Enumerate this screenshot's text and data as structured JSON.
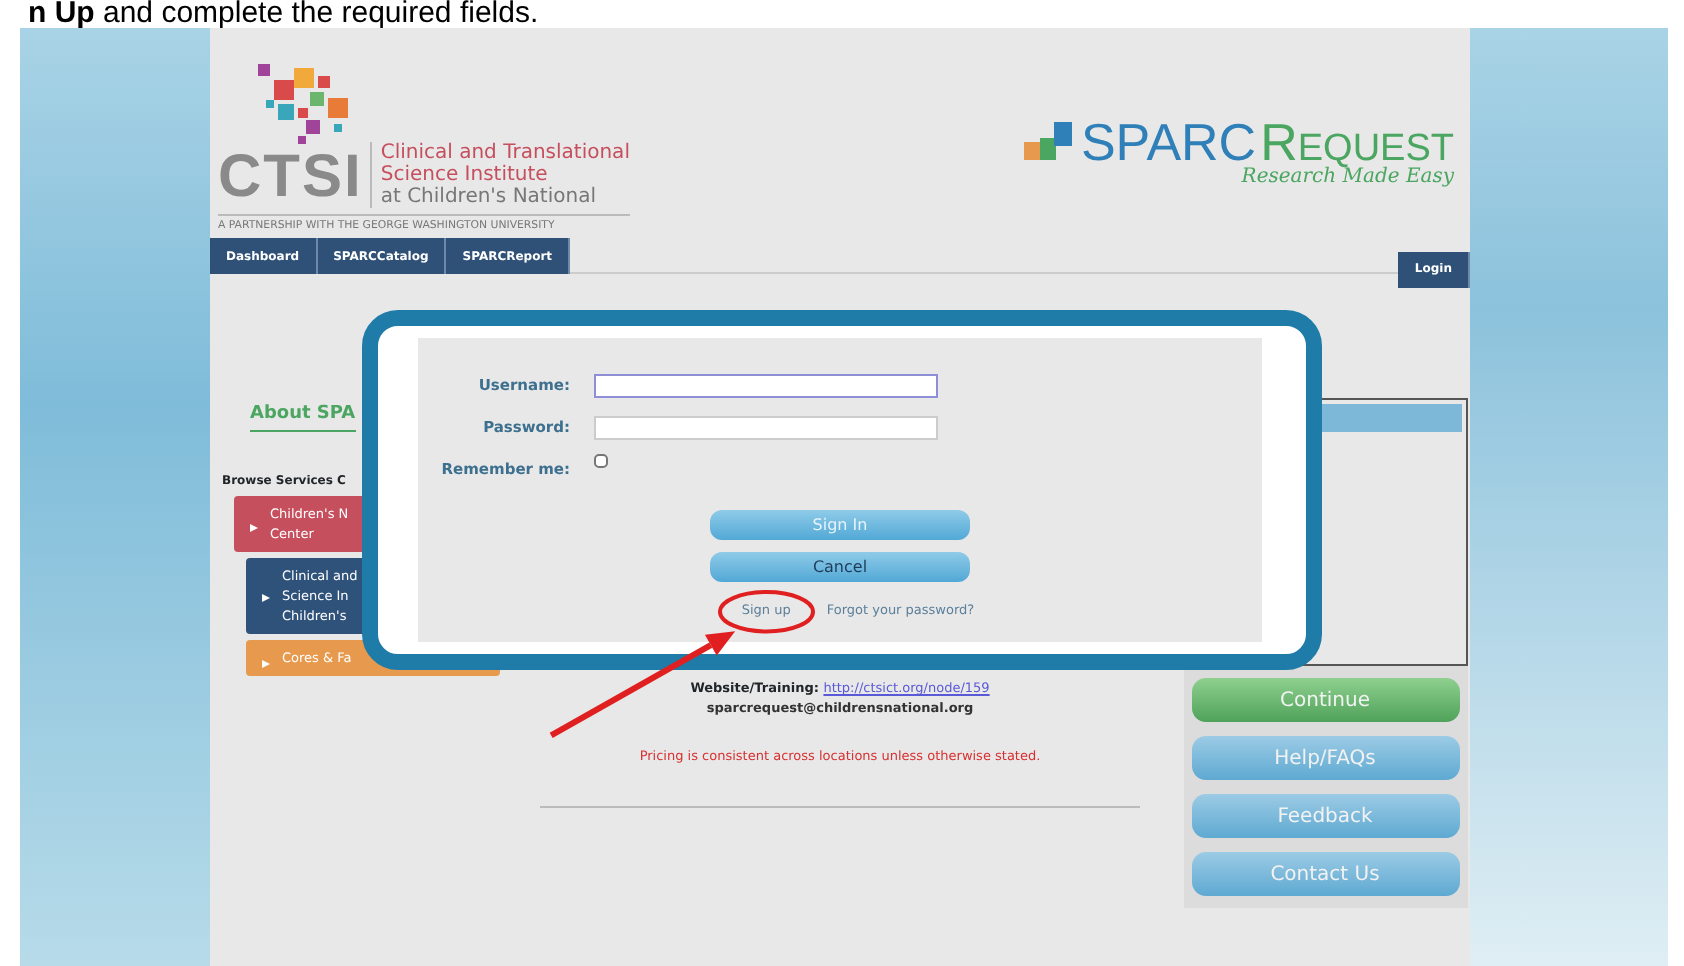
{
  "caption": "**n Up** and complete the required fields.",
  "header": {
    "org_abbr": "CTSI",
    "org_name": [
      "Clinical and Translational",
      "Science Institute",
      "at Children's National"
    ],
    "partnership": "A PARTNERSHIP WITH THE GEORGE WASHINGTON UNIVERSITY",
    "product_name": [
      "SPARC",
      "REQUEST"
    ],
    "tagline": "Research Made Easy"
  },
  "nav": {
    "items": [
      {
        "label": "Dashboard"
      },
      {
        "label": "SPARCCatalog"
      },
      {
        "label": "SPARCReport"
      }
    ],
    "login": "Login"
  },
  "about_title": "About SPA",
  "browse_title": "Browse Services C",
  "categories": [
    {
      "lines": [
        "Children's N",
        "Center"
      ],
      "color": "#c64f5e",
      "children": [
        {
          "lines": [
            "Clinical and",
            "Science In",
            "Children's"
          ],
          "color": "#2f527a"
        },
        {
          "lines": [
            "Cores & Fa"
          ],
          "color": "#e79a4d"
        }
      ]
    }
  ],
  "login_form": {
    "fields": [
      {
        "label": "Username:",
        "kind": "text",
        "focused": true
      },
      {
        "label": "Password:",
        "kind": "password",
        "focused": false
      },
      {
        "label": "Remember me:",
        "kind": "checkbox",
        "checked": false
      }
    ],
    "buttons": [
      {
        "label": "Sign In",
        "kind": "primary"
      },
      {
        "label": "Cancel",
        "kind": "secondary"
      }
    ],
    "links": [
      "Sign up",
      "Forgot your password?"
    ]
  },
  "contact": {
    "website_label": "Website/Training:",
    "website_url": "http://ctsict.org/node/159",
    "email": "sparcrequest@childrensnational.org",
    "pricing_note": "Pricing is consistent across locations unless otherwise stated."
  },
  "side_buttons": [
    {
      "label": "Continue",
      "kind": "primary"
    },
    {
      "label": "Help/FAQs",
      "kind": "secondary"
    },
    {
      "label": "Feedback",
      "kind": "secondary"
    },
    {
      "label": "Contact Us",
      "kind": "secondary"
    }
  ]
}
